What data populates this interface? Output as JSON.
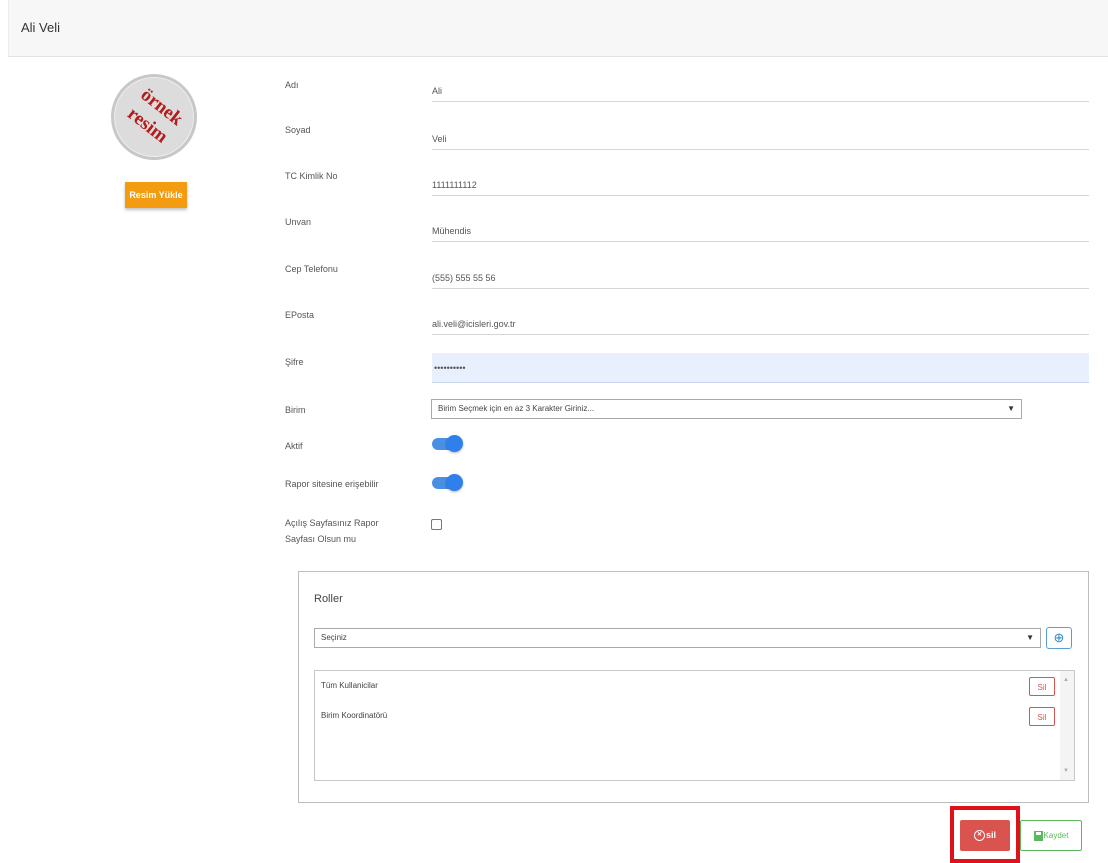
{
  "header": {
    "title": "Ali Veli"
  },
  "avatar": {
    "stamp_line1": "örnek",
    "stamp_line2": "resim",
    "upload_label": "Resim Yükle"
  },
  "form": {
    "name_label": "Adı",
    "name_value": "Ali",
    "surname_label": "Soyad",
    "surname_value": "Veli",
    "tc_label": "TC Kimlik No",
    "tc_value": "1111111112",
    "title_label": "Unvan",
    "title_value": "Mühendis",
    "phone_label": "Cep Telefonu",
    "phone_value": "(555) 555 55 56",
    "email_label": "EPosta",
    "email_value": "ali.veli@icisleri.gov.tr",
    "password_label": "Şifre",
    "password_value": "••••••••••",
    "unit_label": "Birim",
    "unit_placeholder": "Birim Seçmek için en az 3 Karakter Giriniz...",
    "active_label": "Aktif",
    "active_on": true,
    "report_access_label": "Rapor sitesine erişebilir",
    "report_access_on": true,
    "landing_label_line1": "Açılış Sayfasınız Rapor",
    "landing_label_line2": "Sayfası Olsun mu",
    "landing_checked": false
  },
  "roles": {
    "title": "Roller",
    "select_placeholder": "Seçiniz",
    "add_icon": "plus-circle-icon",
    "items": [
      {
        "name": "Tüm Kullanicilar",
        "delete_label": "Sil"
      },
      {
        "name": "Birim Koordinatörü",
        "delete_label": "Sil"
      }
    ]
  },
  "actions": {
    "delete_label": "sil",
    "save_label": "Kaydet"
  },
  "colors": {
    "accent": "#2f80ed",
    "upload": "#f39c12",
    "danger": "#d9534f",
    "success": "#5cb85c",
    "highlight": "#e0111b"
  }
}
